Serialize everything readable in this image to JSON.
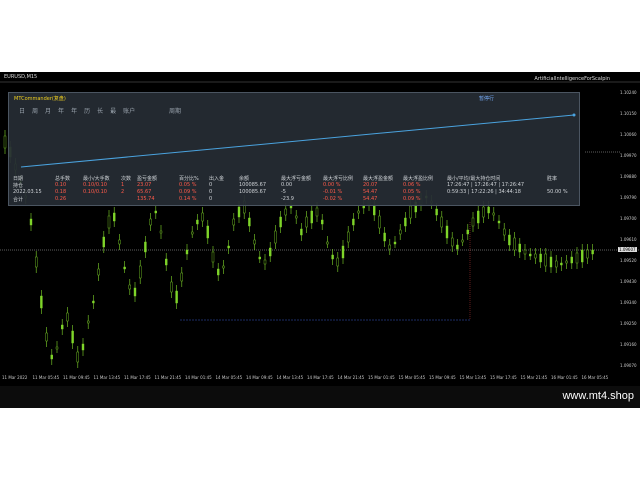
{
  "chart": {
    "symbol": "EURUSD,M15",
    "expert": "ArtificialIntelligenceForScalpin",
    "price_levels": [
      "1.10240",
      "1.10150",
      "1.10060",
      "1.09970",
      "1.09880",
      "1.09790",
      "1.09700",
      "1.09610",
      "1.09520",
      "1.09430",
      "1.09340",
      "1.09250",
      "1.09160",
      "1.09070"
    ],
    "current_price": "1.09607",
    "time_labels": [
      "11 Mar 2022",
      "11 Mar 05:45",
      "11 Mar 09:45",
      "11 Mar 13:45",
      "11 Mar 17:45",
      "11 Mar 21:45",
      "14 Mar 01:45",
      "14 Mar 05:45",
      "14 Mar 09:45",
      "14 Mar 13:45",
      "14 Mar 17:45",
      "14 Mar 21:45",
      "15 Mar 01:45",
      "15 Mar 05:45",
      "15 Mar 09:45",
      "15 Mar 13:45",
      "15 Mar 17:45",
      "15 Mar 21:45",
      "16 Mar 01:45",
      "16 Mar 05:45"
    ]
  },
  "panel": {
    "title": "MTCommander(复盘)",
    "action_button": "暂停行",
    "tabs": [
      "日",
      "周",
      "月",
      "年",
      "年",
      "历",
      "长",
      "最",
      "账户"
    ],
    "tab_date": "周期",
    "equity_label": "2022.03.15",
    "stats": {
      "headers": [
        "日期",
        "总手数",
        "最小/大手数",
        "次数",
        "盈亏金额",
        "百分比%",
        "出入金",
        "余额",
        "最大浮亏金额",
        "最大浮亏比例",
        "最大浮盈金额",
        "最大浮盈比例",
        "最小/平均/最大持仓时间",
        "胜率"
      ],
      "rows": [
        [
          "持仓",
          "0.10",
          "0.10/0.10",
          "1",
          "23.07",
          "0.05 %",
          "0",
          "100085.67",
          "0.00",
          "0.00 %",
          "20.07",
          "0.06 %",
          "17:26:47 | 17:26:47 | 17:26:47",
          ""
        ],
        [
          "2022.03.15",
          "0.18",
          "0.10/0.10",
          "2",
          "65.67",
          "0.09 %",
          "0",
          "100085.67",
          "-5",
          "-0.01 %",
          "54.47",
          "0.05 %",
          "0:59:33 | 17:22:26 | 34:44:18",
          "50.00 %"
        ],
        [
          "合计",
          "0.26",
          "",
          "",
          "135.74",
          "0.14 %",
          "0",
          "",
          "-23.9",
          "-0.02 %",
          "54.47",
          "0.09 %",
          "",
          ""
        ]
      ]
    }
  },
  "footer": {
    "watermark": "www.mt4.shop"
  },
  "colors": {
    "candle": "#7fd52a",
    "equity_line": "#4aa3df",
    "loss": "#ff5a4a",
    "title": "#f0d020"
  }
}
